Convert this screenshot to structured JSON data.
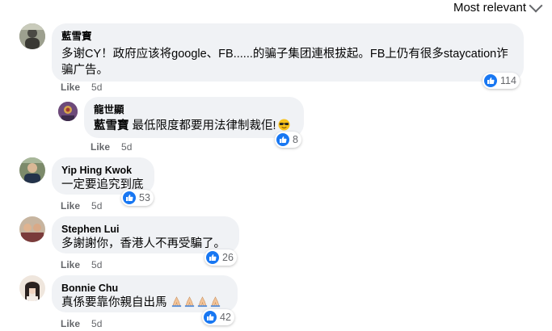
{
  "header": {
    "sort_label": "Most relevant"
  },
  "comments": [
    {
      "author": "藍雪寶",
      "line1": "多谢CY！政府应该将google、FB......的骗子集团連根拔起。FB上仍有很多staycation诈",
      "line2": "骗广告。",
      "like": "Like",
      "time": "5d",
      "reactions": "114",
      "reply": {
        "author": "龍世顯",
        "mention": "藍雪寶",
        "text": " 最低限度都要用法律制裁佢!",
        "like": "Like",
        "time": "5d",
        "reactions": "8"
      }
    },
    {
      "author": "Yip Hing Kwok",
      "text": "一定要追究到底",
      "like": "Like",
      "time": "5d",
      "reactions": "53"
    },
    {
      "author": "Stephen Lui",
      "text": "多謝謝你，香港人不再受騙了。",
      "like": "Like",
      "time": "5d",
      "reactions": "26"
    },
    {
      "author": "Bonnie Chu",
      "text": "真係要靠你親自出馬",
      "like": "Like",
      "time": "5d",
      "reactions": "42"
    }
  ],
  "colors": {
    "bubble": "#f0f2f5",
    "like_blue": "#1877f2",
    "meta_gray": "#65676b"
  },
  "icons": [
    "chevron-down-icon",
    "like-thumb-icon",
    "sunglasses-emoji-icon",
    "praying-hands-emoji-icon"
  ]
}
